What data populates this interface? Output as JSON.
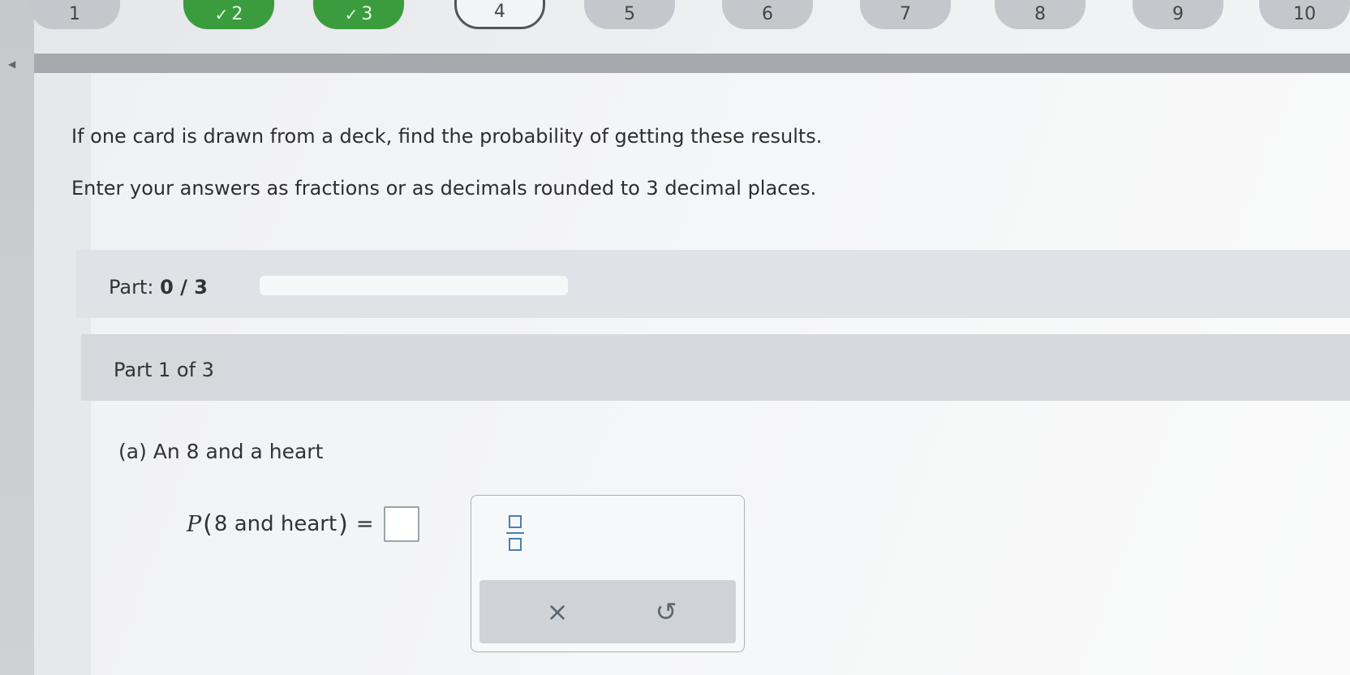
{
  "question_nav": [
    {
      "label": "1",
      "state": "default"
    },
    {
      "label": "2",
      "state": "done"
    },
    {
      "label": "3",
      "state": "done"
    },
    {
      "label": "4",
      "state": "current"
    },
    {
      "label": "5",
      "state": "default"
    },
    {
      "label": "6",
      "state": "default"
    },
    {
      "label": "7",
      "state": "default"
    },
    {
      "label": "8",
      "state": "default"
    },
    {
      "label": "9",
      "state": "default"
    },
    {
      "label": "10",
      "state": "default"
    }
  ],
  "prompt": {
    "line1": "If one card is drawn from a deck, find the probability of getting these results.",
    "line2": "Enter your answers as fractions or as decimals rounded to 3 decimal places."
  },
  "progress": {
    "label": "Part:",
    "value": "0 / 3",
    "fraction": 0
  },
  "part_header": "Part 1 of 3",
  "question": {
    "text": "(a) An 8 and a heart",
    "eq_var": "P",
    "eq_args": "8 and heart",
    "eq_sign": "="
  },
  "palette": {
    "clear_symbol": "×",
    "undo_symbol": "↺"
  },
  "icons": {
    "check": "check-icon",
    "fraction": "fraction-icon",
    "clear": "close-icon",
    "undo": "undo-icon"
  },
  "colors": {
    "done": "#3b9c3d",
    "accent": "#4a7fb5"
  }
}
